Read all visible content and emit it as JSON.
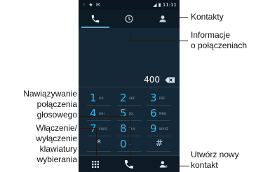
{
  "status_bar": {
    "left_icons": "◦ ★ ✉",
    "right_icons": "◢ ▮",
    "time": "11:11"
  },
  "tabs": [
    {
      "icon": "phone-icon",
      "active": true
    },
    {
      "icon": "clock-icon",
      "active": false
    },
    {
      "icon": "person-icon",
      "active": false
    }
  ],
  "dial_display": {
    "number": "400",
    "backspace_icon": "backspace-icon"
  },
  "keypad": [
    {
      "digit": "1",
      "letters": "GO"
    },
    {
      "digit": "2",
      "letters": "ABC"
    },
    {
      "digit": "3",
      "letters": "DEF"
    },
    {
      "digit": "4",
      "letters": "GHI"
    },
    {
      "digit": "5",
      "letters": "JKL"
    },
    {
      "digit": "6",
      "letters": "MNO"
    },
    {
      "digit": "7",
      "letters": "PQRS"
    },
    {
      "digit": "8",
      "letters": "TUV"
    },
    {
      "digit": "9",
      "letters": "WXYZ"
    },
    {
      "symbol": "*"
    },
    {
      "digit": "0",
      "letters": "+"
    },
    {
      "symbol": "#"
    }
  ],
  "bottom_bar": [
    {
      "icon": "keypad-toggle-icon"
    },
    {
      "icon": "call-icon"
    },
    {
      "icon": "add-contact-icon"
    }
  ],
  "callouts": {
    "contacts": "Kontakty",
    "call_info_1": "Informacje",
    "call_info_2": "o połączeniach",
    "voice_call_1": "Nawiązywanie",
    "voice_call_2": "połączenia",
    "voice_call_3": "głosowego",
    "keypad_toggle_1": "Włączenie/",
    "keypad_toggle_2": "wyłączenie",
    "keypad_toggle_3": "klawiatury",
    "keypad_toggle_4": "wybierania",
    "new_contact_1": "Utwórz nowy",
    "new_contact_2": "kontakt"
  },
  "colors": {
    "accent": "#33b5e5",
    "screen_bg": "#152838"
  }
}
